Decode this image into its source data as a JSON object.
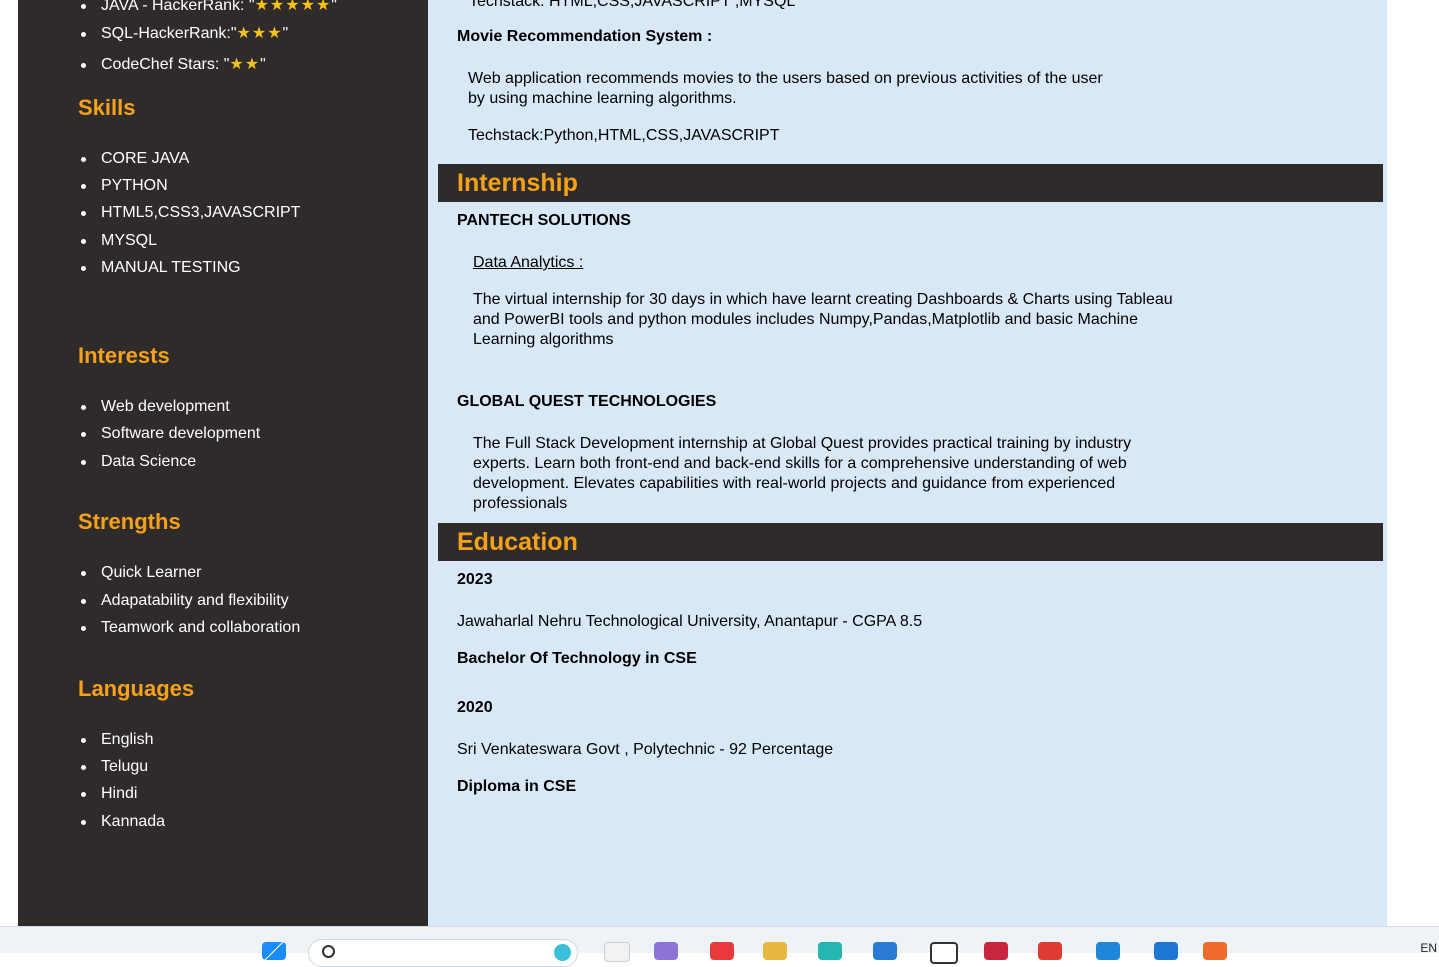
{
  "sidebar": {
    "achievements": [
      {
        "label": "JAVA - HackerRank: \"",
        "stars": "★★★★★",
        "close": "\""
      },
      {
        "label": "SQL-HackerRank:\"",
        "stars": "★★★",
        "close": "\""
      },
      {
        "label": "CodeChef Stars: \"",
        "stars": "★★",
        "close": "\""
      }
    ],
    "skills": {
      "heading": "Skills",
      "items": [
        "CORE JAVA",
        "PYTHON",
        "HTML5,CSS3,JAVASCRIPT",
        "MYSQL",
        "MANUAL TESTING"
      ]
    },
    "interests": {
      "heading": "Interests",
      "items": [
        "Web development",
        "Software development",
        "Data Science"
      ]
    },
    "strengths": {
      "heading": "Strengths",
      "items": [
        "Quick Learner",
        "Adapatability and flexibility",
        "Teamwork and collaboration"
      ]
    },
    "languages": {
      "heading": "Languages",
      "items": [
        "English",
        "Telugu",
        "Hindi",
        "Kannada"
      ]
    }
  },
  "main": {
    "projects": {
      "previous_techstack": "Techstack: HTML,CSS,JAVASCRIPT ,MYSQL",
      "movie": {
        "title": "Movie Recommendation System :",
        "description": "Web application recommends movies to the users based on previous activities of the user by using machine learning algorithms.",
        "techstack": "Techstack:Python,HTML,CSS,JAVASCRIPT"
      }
    },
    "internship": {
      "heading": "Internship",
      "entries": [
        {
          "company": "PANTECH SOLUTIONS",
          "role": "Data Analytics :",
          "description": "The virtual internship for 30 days in which have learnt creating Dashboards & Charts using Tableau and PowerBI tools and python modules includes Numpy,Pandas,Matplotlib and basic Machine Learning algorithms"
        },
        {
          "company": "GLOBAL QUEST TECHNOLOGIES",
          "description": "The Full Stack Development internship at Global Quest provides practical training by industry experts. Learn both front-end and back-end skills for a comprehensive understanding of web development. Elevates capabilities with real-world projects and guidance from experienced professionals"
        }
      ]
    },
    "education": {
      "heading": "Education",
      "entries": [
        {
          "year": "2023",
          "institution": "Jawaharlal Nehru Technological University, Anantapur - CGPA  8.5",
          "degree": "Bachelor Of Technology in CSE"
        },
        {
          "year": "2020",
          "institution": "Sri Venkateswara Govt , Polytechnic - 92 Percentage",
          "degree": "Diploma in CSE"
        }
      ]
    }
  },
  "taskbar": {
    "language": "EN",
    "icons": [
      "windows-start-icon",
      "search-icon",
      "browser-icon",
      "app-icon",
      "folder-icon",
      "edge-icon",
      "mail-icon",
      "chrome-icon",
      "vscode-icon"
    ]
  }
}
